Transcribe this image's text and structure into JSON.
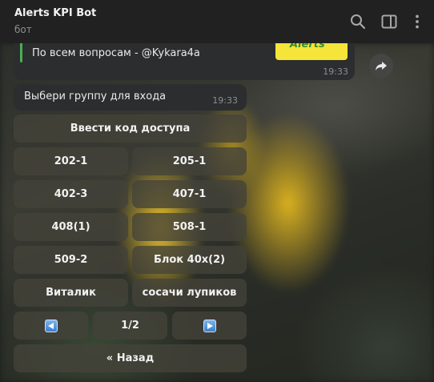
{
  "header": {
    "title": "Alerts KPI Bot",
    "subtitle": "бот",
    "icons": [
      "search-icon",
      "sidebar-toggle-icon",
      "more-vertical-icon"
    ]
  },
  "messages": {
    "previous": {
      "text": "По всем вопросам - @Kykara4a",
      "time": "19:33",
      "thumbnail_text": "Alerts"
    },
    "current": {
      "text": "Выбери группу для входа",
      "time": "19:33"
    }
  },
  "keyboard": {
    "access_code": "Ввести код доступа",
    "rows": [
      [
        "202-1",
        "205-1"
      ],
      [
        "402-3",
        "407-1"
      ],
      [
        "408(1)",
        "508-1"
      ],
      [
        "509-2",
        "Блок 40x(2)"
      ],
      [
        "Виталик",
        "сосачи лупиков"
      ]
    ],
    "pager": {
      "prev_icon": "arrow-left-icon",
      "page": "1/2",
      "next_icon": "arrow-right-icon"
    },
    "back": "« Назад"
  },
  "colors": {
    "header_bg": "#212121",
    "bubble_bg": "#2b2d2f",
    "quote_accent": "#4cae4f",
    "thumbnail_bg": "#f5e43a"
  }
}
